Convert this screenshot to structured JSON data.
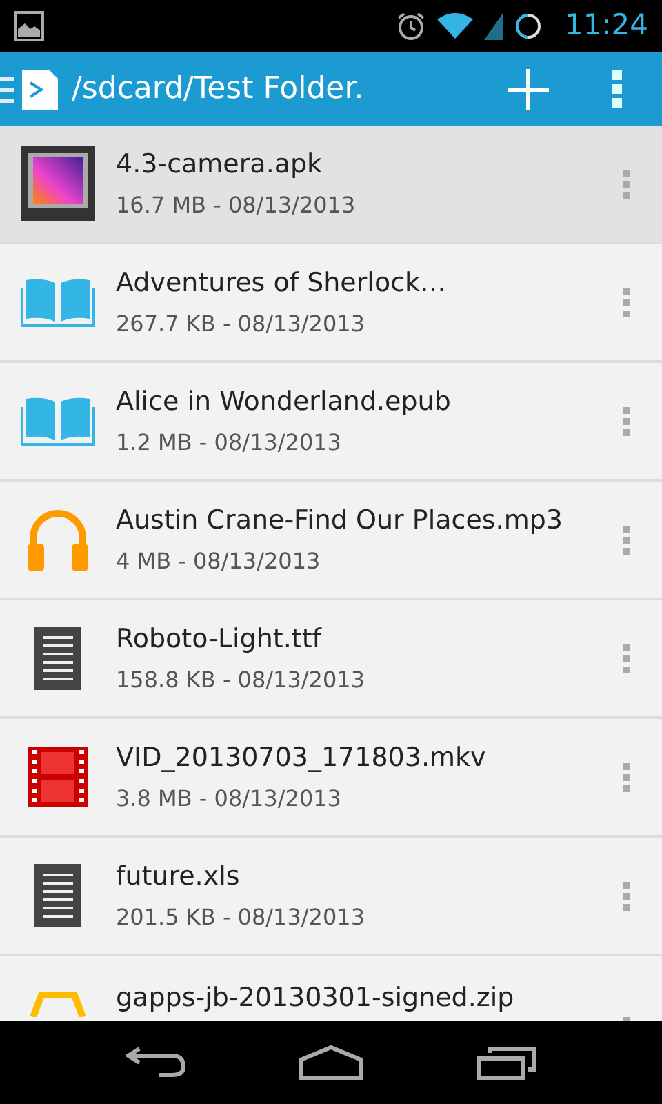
{
  "status_bar": {
    "time": "11:24"
  },
  "action_bar": {
    "title": "/sdcard/Test Folder."
  },
  "files": [
    {
      "kind": "apk",
      "name": "4.3-camera.apk",
      "details": "16.7 MB - 08/13/2013",
      "selected": true
    },
    {
      "kind": "book",
      "name": "Adventures of Sherlock…",
      "details": "267.7 KB - 08/13/2013",
      "selected": false
    },
    {
      "kind": "book",
      "name": "Alice in Wonderland.epub",
      "details": "1.2 MB - 08/13/2013",
      "selected": false
    },
    {
      "kind": "audio",
      "name": "Austin Crane-Find Our Places.mp3",
      "details": "4 MB - 08/13/2013",
      "selected": false
    },
    {
      "kind": "text",
      "name": "Roboto-Light.ttf",
      "details": "158.8 KB - 08/13/2013",
      "selected": false
    },
    {
      "kind": "video",
      "name": "VID_20130703_171803.mkv",
      "details": "3.8 MB - 08/13/2013",
      "selected": false
    },
    {
      "kind": "text",
      "name": "future.xls",
      "details": "201.5 KB - 08/13/2013",
      "selected": false
    },
    {
      "kind": "zip",
      "name": "gapps-jb-20130301-signed.zip",
      "selected": false
    }
  ]
}
